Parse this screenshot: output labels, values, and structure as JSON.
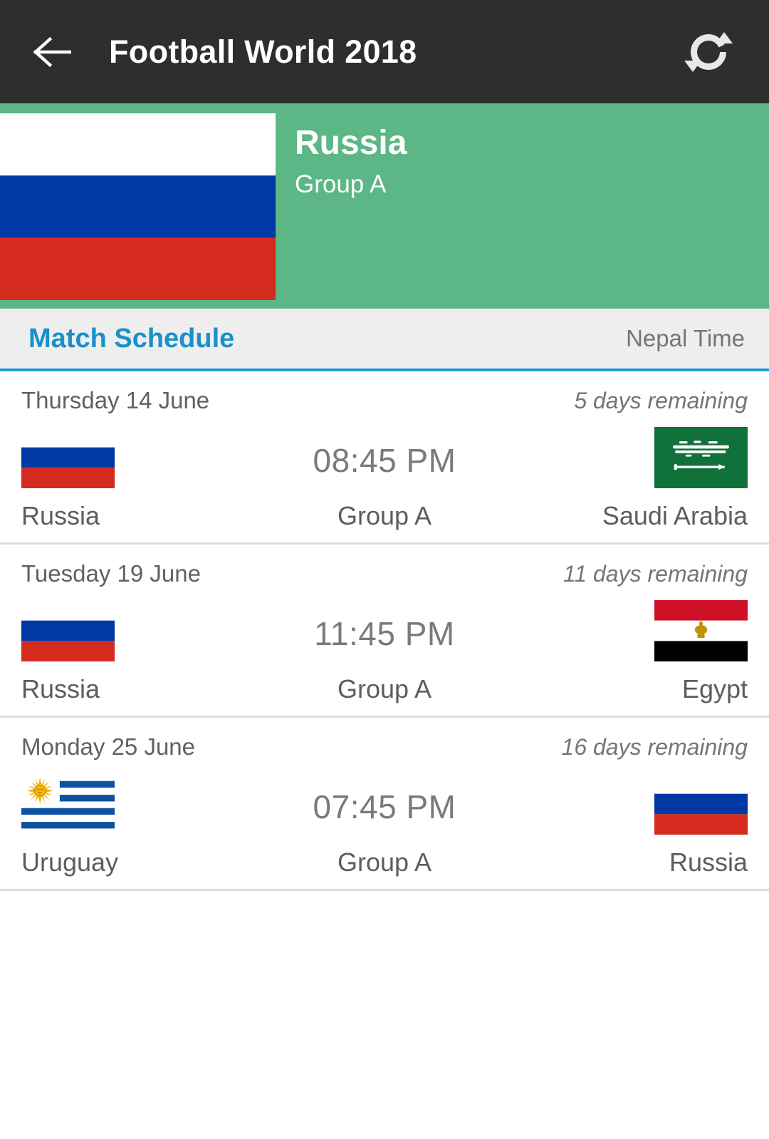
{
  "appbar": {
    "back_icon": "arrow-left-icon",
    "title": "Football World 2018",
    "refresh_icon": "refresh-icon"
  },
  "hero": {
    "country": "Russia",
    "group": "Group A",
    "flag": "russia-flag",
    "background_color": "#5cb685"
  },
  "section": {
    "title": "Match Schedule",
    "timezone": "Nepal Time",
    "title_color": "#1a90c9",
    "underline_color": "#2196d3"
  },
  "matches": [
    {
      "date": "Thursday 14 June",
      "remaining": "5 days remaining",
      "time": "08:45 PM",
      "group": "Group A",
      "home": {
        "name": "Russia",
        "flag": "russia-flag"
      },
      "away": {
        "name": "Saudi Arabia",
        "flag": "saudi-arabia-flag"
      }
    },
    {
      "date": "Tuesday 19 June",
      "remaining": "11 days remaining",
      "time": "11:45 PM",
      "group": "Group A",
      "home": {
        "name": "Russia",
        "flag": "russia-flag"
      },
      "away": {
        "name": "Egypt",
        "flag": "egypt-flag"
      }
    },
    {
      "date": "Monday 25 June",
      "remaining": "16 days remaining",
      "time": "07:45 PM",
      "group": "Group A",
      "home": {
        "name": "Uruguay",
        "flag": "uruguay-flag"
      },
      "away": {
        "name": "Russia",
        "flag": "russia-flag"
      }
    }
  ],
  "colors": {
    "appbar_background": "#2e2e2e",
    "russia_white": "#ffffff",
    "russia_blue": "#0039a6",
    "russia_red": "#d52b1e",
    "saudi_green": "#11713a",
    "egypt_red": "#ce1126",
    "egypt_black": "#000000",
    "egypt_gold": "#c09300",
    "uruguay_blue": "#0d51a0",
    "uruguay_sun": "#f6b40e"
  }
}
